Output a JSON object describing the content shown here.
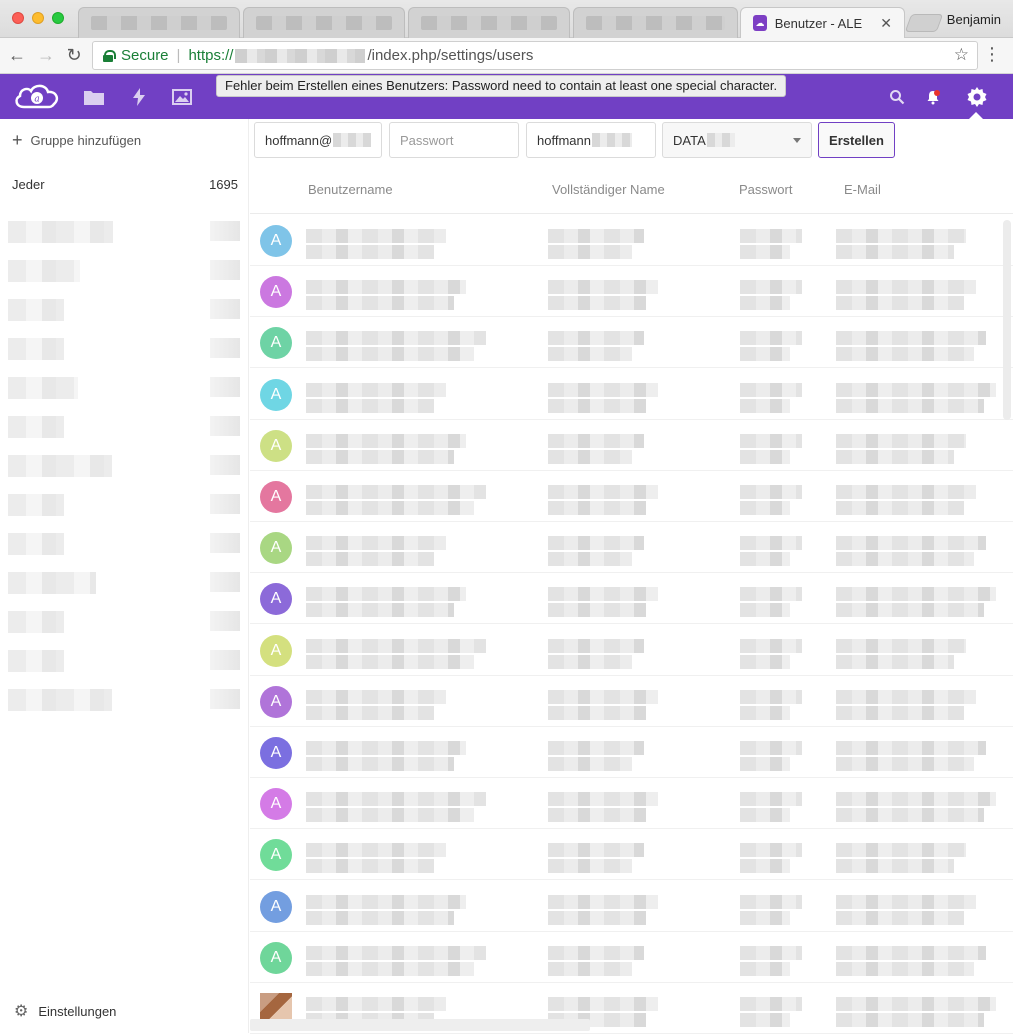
{
  "browser": {
    "profile_name": "Benjamin",
    "active_tab_title": "Benutzer - ALE Own",
    "url_secure_label": "Secure",
    "url_scheme": "https://",
    "url_path": "/index.php/settings/users"
  },
  "header": {
    "error_message": "Fehler beim Erstellen eines Benutzers: Password need to contain at least one special character.",
    "icons": [
      "logo-icon",
      "files-icon",
      "activity-icon",
      "gallery-icon",
      "search-icon",
      "notifications-icon",
      "settings-icon"
    ]
  },
  "sidebar": {
    "add_group_label": "Gruppe hinzufügen",
    "everyone_label": "Jeder",
    "everyone_count": "1695",
    "settings_label": "Einstellungen"
  },
  "form": {
    "username_value": "hoffmann@",
    "password_placeholder": "Passwort",
    "displayname_value": "hoffmann",
    "group_select_value": "DATA",
    "create_button": "Erstellen"
  },
  "table": {
    "headers": [
      "Benutzername",
      "Vollständiger Name",
      "Passwort",
      "E-Mail"
    ],
    "avatar_colors": [
      "#7fc4e8",
      "#cb78e0",
      "#6ed3a5",
      "#6fd6e4",
      "#cde085",
      "#e4779f",
      "#a9d783",
      "#8c6ad9",
      "#d4e07f",
      "#b074d9",
      "#7b6fe0",
      "#d47be6",
      "#70dc99",
      "#739ee0",
      "#6fd69a",
      "photo"
    ],
    "avatar_letter": "A"
  },
  "colors": {
    "brand": "#7140c4",
    "create_border": "#7140c4"
  }
}
